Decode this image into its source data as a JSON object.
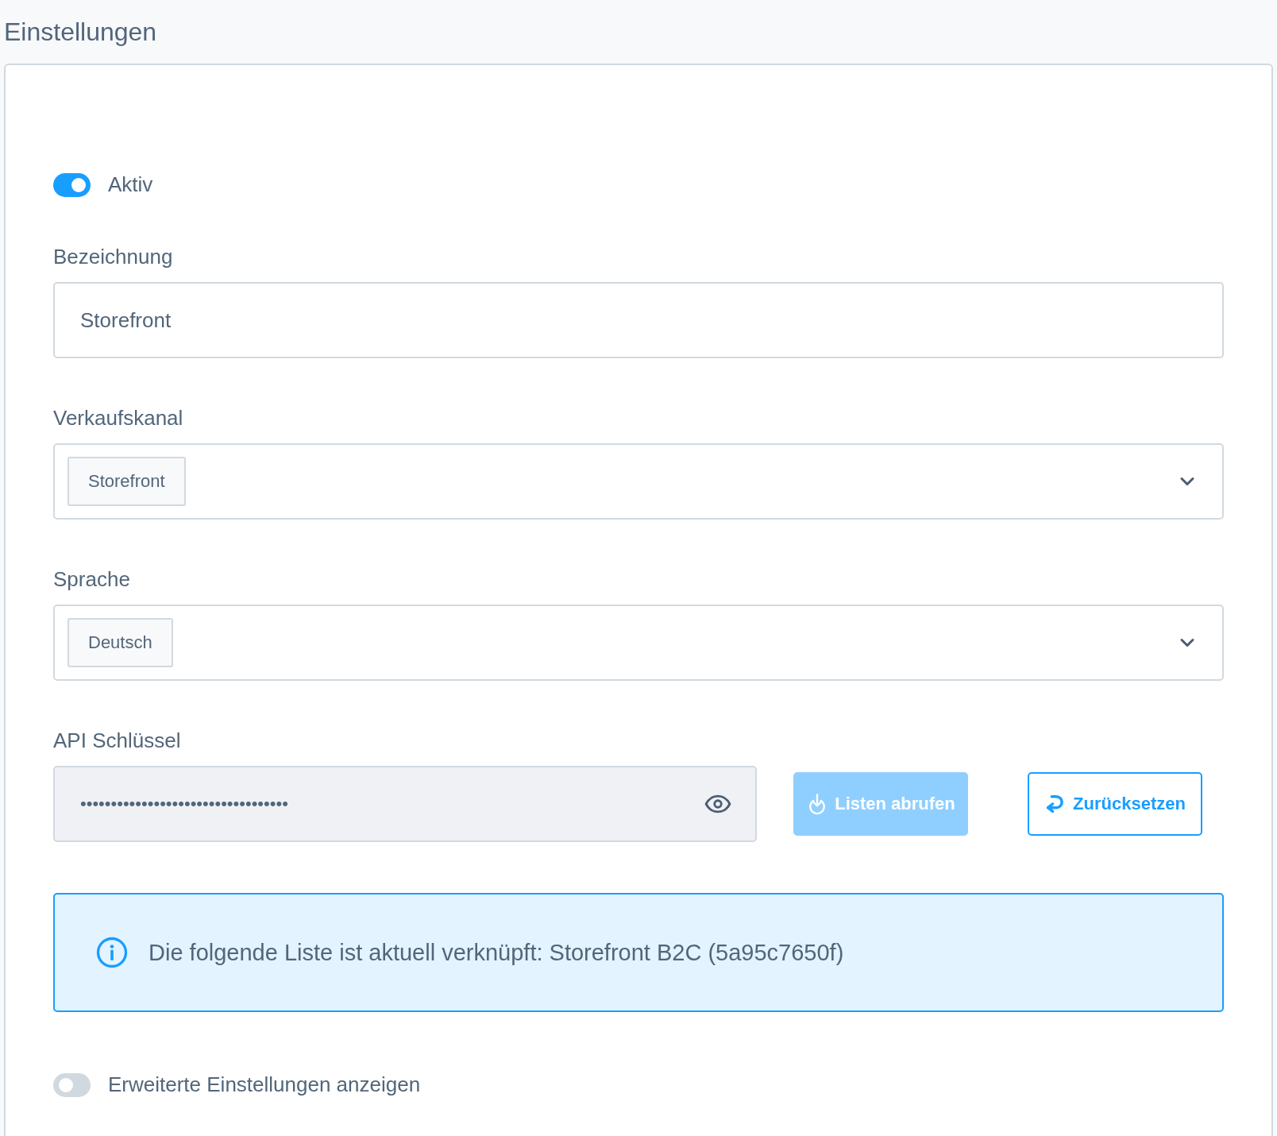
{
  "page": {
    "title": "Einstellungen"
  },
  "active_toggle": {
    "label": "Aktiv",
    "on": true
  },
  "fields": [
    {
      "kind": "text",
      "label": "Bezeichnung",
      "value": "Storefront"
    },
    {
      "kind": "select",
      "label": "Verkaufskanal",
      "value": "Storefront"
    },
    {
      "kind": "select",
      "label": "Sprache",
      "value": "Deutsch"
    },
    {
      "kind": "secret",
      "label": "API Schlüssel",
      "value": "••••••••••••••••••••••••••••••••••",
      "buttons": [
        {
          "kind": "fetch",
          "label": "Listen abrufen",
          "disabled": true
        },
        {
          "kind": "reset",
          "label": "Zurücksetzen",
          "disabled": false
        }
      ]
    }
  ],
  "info_notice": {
    "text": "Die folgende Liste ist aktuell verknüpft: Storefront B2C (5a95c7650f)"
  },
  "advanced_toggle": {
    "label": "Erweiterte Einstellungen anzeigen",
    "on": false
  }
}
